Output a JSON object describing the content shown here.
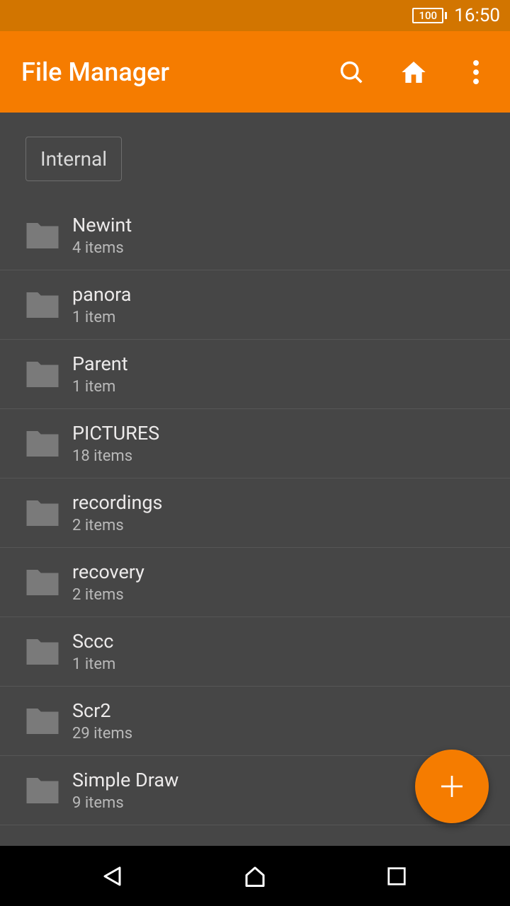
{
  "status": {
    "battery": "100",
    "time": "16:50"
  },
  "header": {
    "title": "File Manager"
  },
  "breadcrumb": {
    "current": "Internal"
  },
  "folders": [
    {
      "name": "Newint",
      "meta": "4 items"
    },
    {
      "name": "panora",
      "meta": "1 item"
    },
    {
      "name": "Parent",
      "meta": "1 item"
    },
    {
      "name": "PICTURES",
      "meta": "18 items"
    },
    {
      "name": "recordings",
      "meta": "2 items"
    },
    {
      "name": "recovery",
      "meta": "2 items"
    },
    {
      "name": "Sccc",
      "meta": "1 item"
    },
    {
      "name": "Scr2",
      "meta": "29 items"
    },
    {
      "name": "Simple Draw",
      "meta": "9 items"
    }
  ],
  "colors": {
    "accent": "#f57c00",
    "status_bar": "#d27500",
    "background": "#464646"
  }
}
